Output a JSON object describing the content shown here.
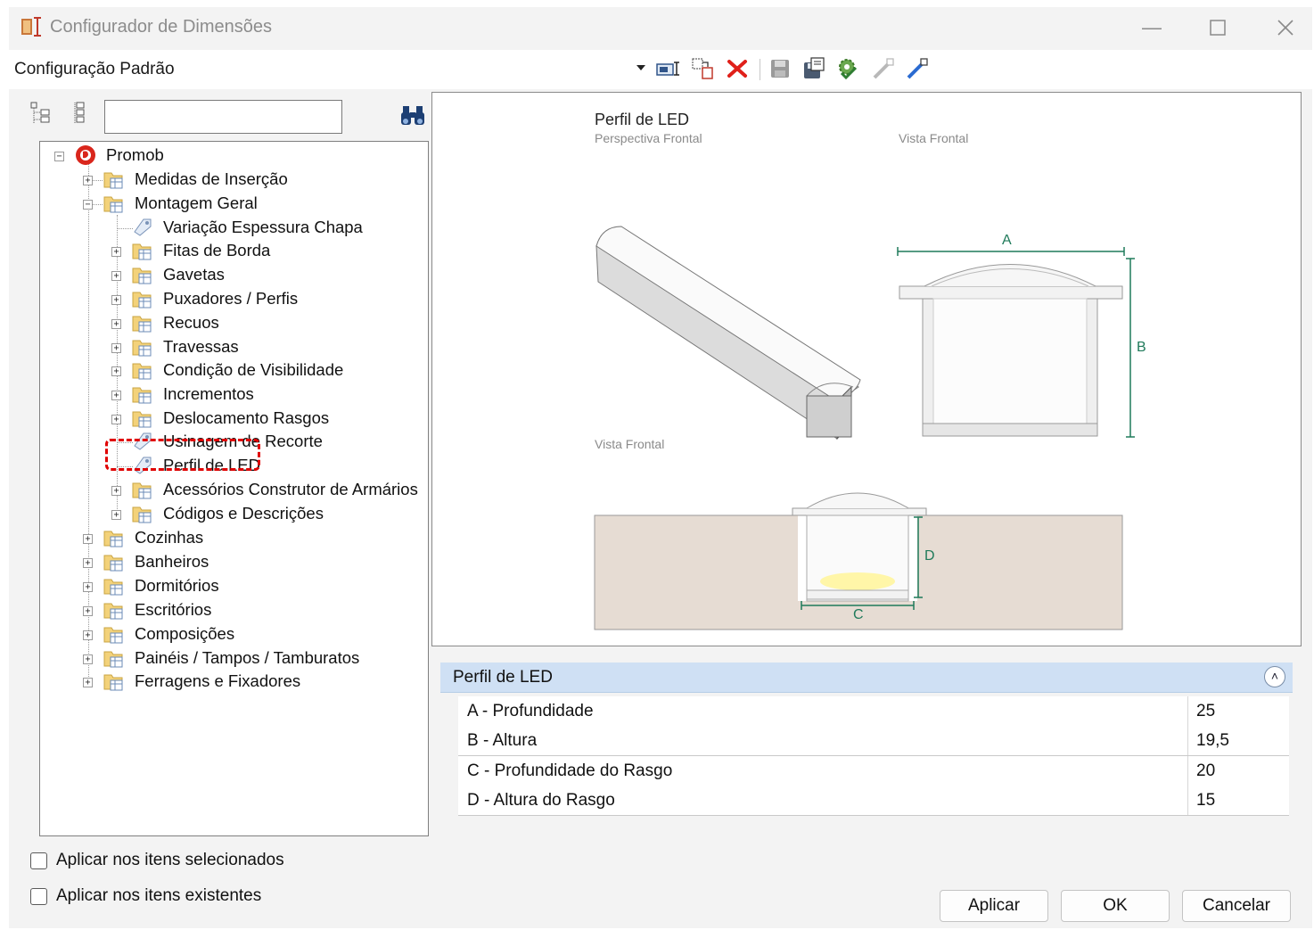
{
  "window": {
    "title": "Configurador de Dimensões"
  },
  "config": {
    "label": "Configuração Padrão"
  },
  "tree": {
    "root": "Promob",
    "level1_expanded_before": [
      "Medidas de Inserção"
    ],
    "montagem": "Montagem Geral",
    "montagem_children": [
      "Variação Espessura Chapa",
      "Fitas de Borda",
      "Gavetas",
      "Puxadores / Perfis",
      "Recuos",
      "Travessas",
      "Condição de Visibilidade",
      "Incrementos",
      "Deslocamento Rasgos",
      "Usinagem de Recorte",
      "Perfil de LED",
      "Acessórios Construtor de Armários",
      "Códigos e Descrições"
    ],
    "level1_after": [
      "Cozinhas",
      "Banheiros",
      "Dormitórios",
      "Escritórios",
      "Composições",
      "Painéis / Tampos / Tamburatos",
      "Ferragens e Fixadores"
    ]
  },
  "preview": {
    "title": "Perfil de LED",
    "sub_perspective": "Perspectiva Frontal",
    "sub_front_top": "Vista Frontal",
    "sub_front_bottom": "Vista Frontal",
    "dim_a": "A",
    "dim_b": "B",
    "dim_c": "C",
    "dim_d": "D"
  },
  "props": {
    "header": "Perfil de LED",
    "rows": [
      {
        "name": "A - Profundidade",
        "value": "25"
      },
      {
        "name": "B - Altura",
        "value": "19,5"
      },
      {
        "name": "C - Profundidade do Rasgo",
        "value": "20"
      },
      {
        "name": "D - Altura do Rasgo",
        "value": "15"
      }
    ]
  },
  "options": {
    "apply_selected": "Aplicar nos itens selecionados",
    "apply_existing": "Aplicar nos itens existentes"
  },
  "buttons": {
    "apply": "Aplicar",
    "ok": "OK",
    "cancel": "Cancelar"
  },
  "icons": [
    "app-icon",
    "minimize-icon",
    "maximize-icon",
    "close-icon",
    "dropdown-arrow-icon",
    "new-item-icon",
    "copy-icon",
    "delete-icon",
    "save-icon",
    "save-as-icon",
    "settings-icon",
    "import-icon",
    "export-icon",
    "expand-all-icon",
    "collapse-all-icon",
    "binoculars-icon",
    "folder-icon",
    "tag-icon",
    "promob-logo-icon",
    "chevron-up-icon"
  ]
}
